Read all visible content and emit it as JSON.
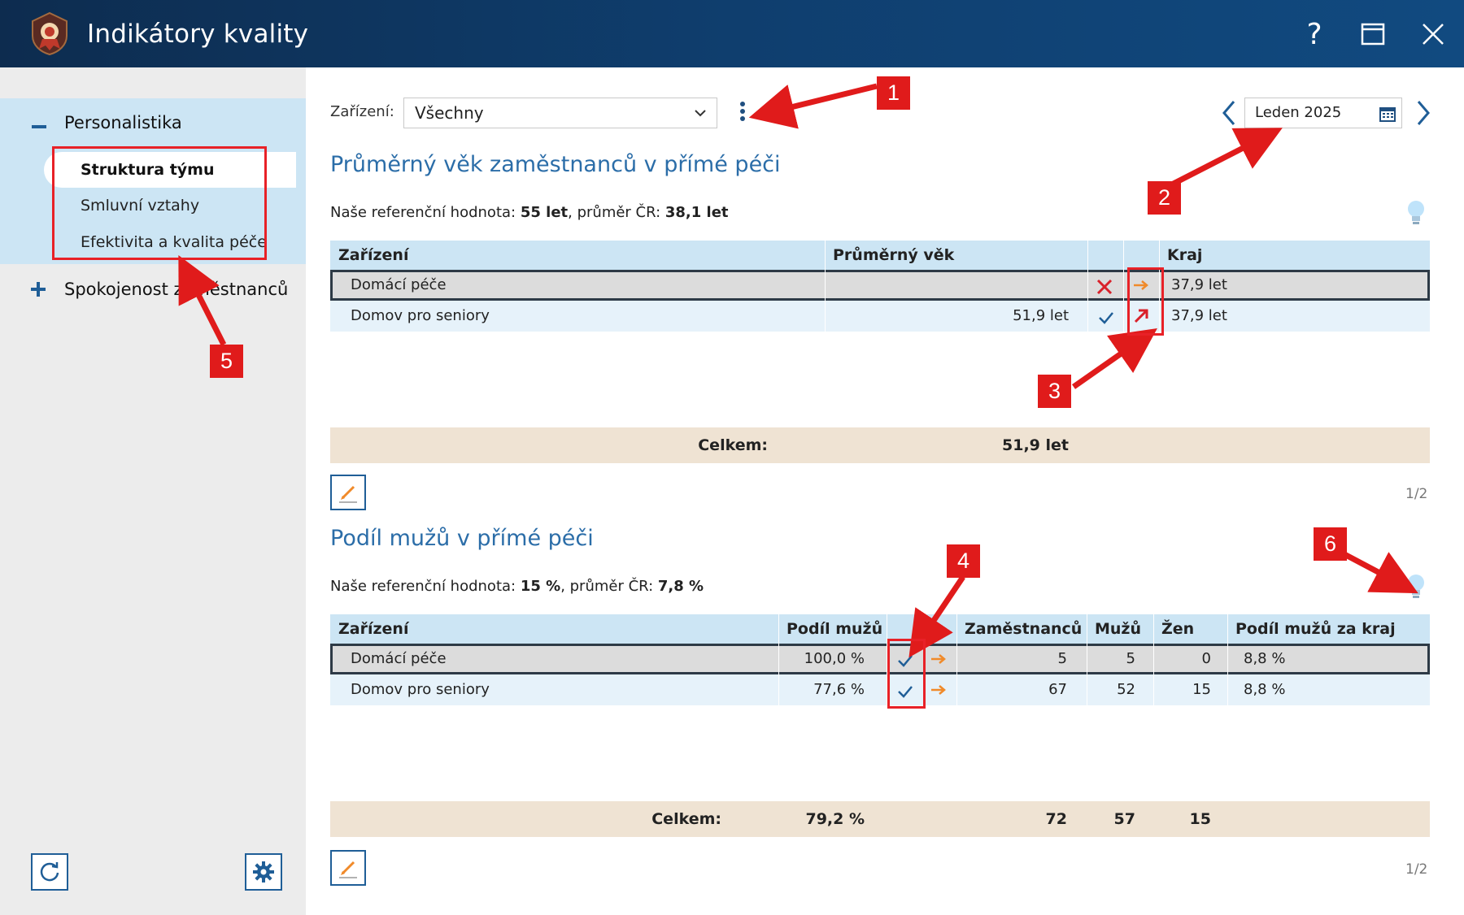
{
  "window": {
    "title": "Indikátory kvality",
    "help_label": "?"
  },
  "sidebar": {
    "group1": {
      "icon": "minus-icon",
      "label": "Personalistika"
    },
    "items": [
      {
        "label": "Struktura týmu",
        "active": true
      },
      {
        "label": "Smluvní vztahy"
      },
      {
        "label": "Efektivita a kvalita péče"
      }
    ],
    "group2": {
      "icon": "plus-icon",
      "label": "Spokojenost zaměstnanců"
    },
    "tools": [
      "refresh-icon",
      "gear-icon"
    ]
  },
  "toolbar": {
    "device_label": "Zařízení:",
    "device_value": "Všechny",
    "month_value": "Leden 2025"
  },
  "section1": {
    "title": "Průměrný věk zaměstnanců v přímé péči",
    "ref_prefix": "Naše referenční hodnota: ",
    "ref_value": "55 let",
    "ref_mid": ", průměr ČR: ",
    "ref_avg": "38,1 let",
    "columns": [
      "Zařízení",
      "Průměrný věk",
      "",
      "",
      "Kraj"
    ],
    "rows": [
      {
        "name": "Domácí péče",
        "age": "",
        "status": "cross",
        "trend": "arrow-right",
        "kraj": "37,9 let"
      },
      {
        "name": "Domov pro seniory",
        "age": "51,9 let",
        "status": "check",
        "trend": "arrow-up-right",
        "kraj": "37,9 let"
      }
    ],
    "footer_label": "Celkem:",
    "footer_value": "51,9 let",
    "pager": "1/2"
  },
  "section2": {
    "title": "Podíl mužů v přímé péči",
    "ref_prefix": "Naše referenční hodnota: ",
    "ref_value": "15 %",
    "ref_mid": ", průměr ČR: ",
    "ref_avg": "7,8 %",
    "columns": [
      "Zařízení",
      "Podíl mužů",
      "",
      "Zaměstnanců",
      "Mužů",
      "Žen",
      "Podíl mužů za kraj"
    ],
    "rows": [
      {
        "name": "Domácí péče",
        "share": "100,0 %",
        "status": "check",
        "trend": "arrow-right",
        "emp": "5",
        "men": "5",
        "women": "0",
        "kraj": "8,8 %"
      },
      {
        "name": "Domov pro seniory",
        "share": "77,6 %",
        "status": "check",
        "trend": "arrow-right",
        "emp": "67",
        "men": "52",
        "women": "15",
        "kraj": "8,8 %"
      }
    ],
    "footer_label": "Celkem:",
    "footer_share": "79,2 %",
    "footer_emp": "72",
    "footer_men": "57",
    "footer_women": "15",
    "pager": "1/2"
  },
  "annotations": [
    "1",
    "2",
    "3",
    "4",
    "5",
    "6"
  ],
  "colors": {
    "titlebar": "#0f3e6e",
    "accent_blue": "#2b6da8",
    "header_bg": "#cce5f4",
    "annotation_red": "#e01b1b",
    "trend_orange": "#f08a2a",
    "cross_red": "#d9212a"
  }
}
